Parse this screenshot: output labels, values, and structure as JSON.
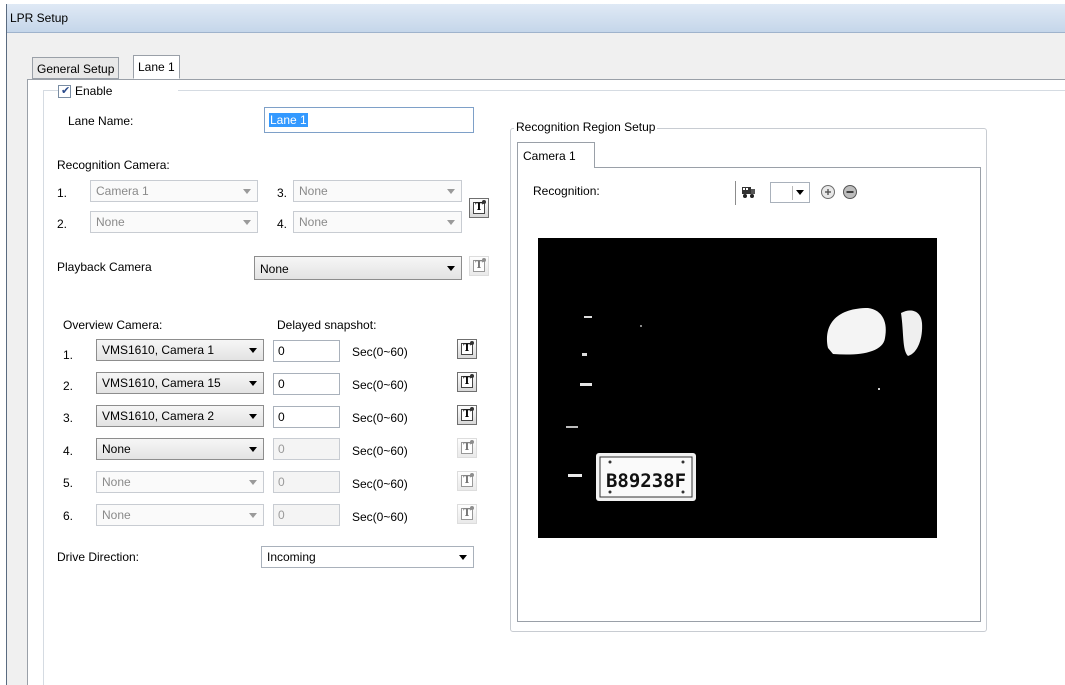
{
  "window": {
    "title": "LPR Setup"
  },
  "tabs": [
    {
      "label": "General Setup",
      "active": false
    },
    {
      "label": "Lane 1",
      "active": true
    }
  ],
  "lane": {
    "enable_label": "Enable",
    "enable_checked": true,
    "lane_name_label": "Lane Name:",
    "lane_name_value": "Lane 1",
    "recognition_camera_label": "Recognition Camera:",
    "recognition_cameras": [
      {
        "index": "1.",
        "value": "Camera 1"
      },
      {
        "index": "2.",
        "value": "None"
      },
      {
        "index": "3.",
        "value": "None"
      },
      {
        "index": "4.",
        "value": "None"
      }
    ],
    "playback_camera_label": "Playback Camera",
    "playback_camera_value": "None",
    "overview_camera_label": "Overview Camera:",
    "delayed_snapshot_label": "Delayed snapshot:",
    "overview_cameras": [
      {
        "index": "1.",
        "camera": "VMS1610, Camera 1",
        "delay": "0",
        "unit": "Sec(0~60)",
        "enabled": true
      },
      {
        "index": "2.",
        "camera": "VMS1610, Camera 15",
        "delay": "0",
        "unit": "Sec(0~60)",
        "enabled": true
      },
      {
        "index": "3.",
        "camera": "VMS1610, Camera 2",
        "delay": "0",
        "unit": "Sec(0~60)",
        "enabled": true
      },
      {
        "index": "4.",
        "camera": "None",
        "delay": "0",
        "unit": "Sec(0~60)",
        "enabled": false
      },
      {
        "index": "5.",
        "camera": "None",
        "delay": "0",
        "unit": "Sec(0~60)",
        "enabled": false
      },
      {
        "index": "6.",
        "camera": "None",
        "delay": "0",
        "unit": "Sec(0~60)",
        "enabled": false
      }
    ],
    "drive_direction_label": "Drive Direction:",
    "drive_direction_value": "Incoming"
  },
  "region_setup": {
    "group_label": "Recognition Region Setup",
    "camera_tab": "Camera 1",
    "recognition_label": "Recognition:",
    "toolbar_icons": [
      "vehicle-icon",
      "region-select",
      "zoom-in-icon",
      "zoom-out-icon"
    ],
    "plate_text": "B89238F"
  }
}
